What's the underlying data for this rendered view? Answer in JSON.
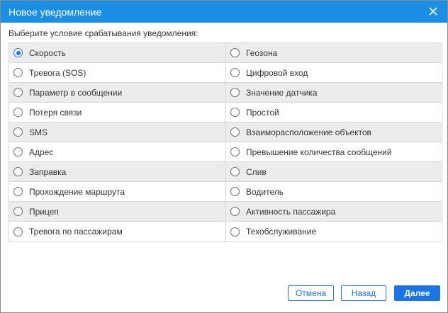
{
  "dialog": {
    "title": "Новое уведомление",
    "close_icon": "close-icon",
    "prompt": "Выберите условие срабатывания уведомления:"
  },
  "options": {
    "selected": "Скорость",
    "left": [
      "Скорость",
      "Тревога (SOS)",
      "Параметр в сообщении",
      "Потеря связи",
      "SMS",
      "Адрес",
      "Заправка",
      "Прохождение маршрута",
      "Прицеп",
      "Тревога по пассажирам"
    ],
    "right": [
      "Геозона",
      "Цифровой вход",
      "Значение датчика",
      "Простой",
      "Взаиморасположение объектов",
      "Превышение количества сообщений",
      "Слив",
      "Водитель",
      "Активность пассажира",
      "Техобслуживание"
    ]
  },
  "buttons": {
    "cancel": "Отмена",
    "back": "Назад",
    "next": "Далее"
  },
  "colors": {
    "titlebar": "#1a8fe3",
    "accent": "#1a73e8",
    "row_shade": "#ececec"
  }
}
